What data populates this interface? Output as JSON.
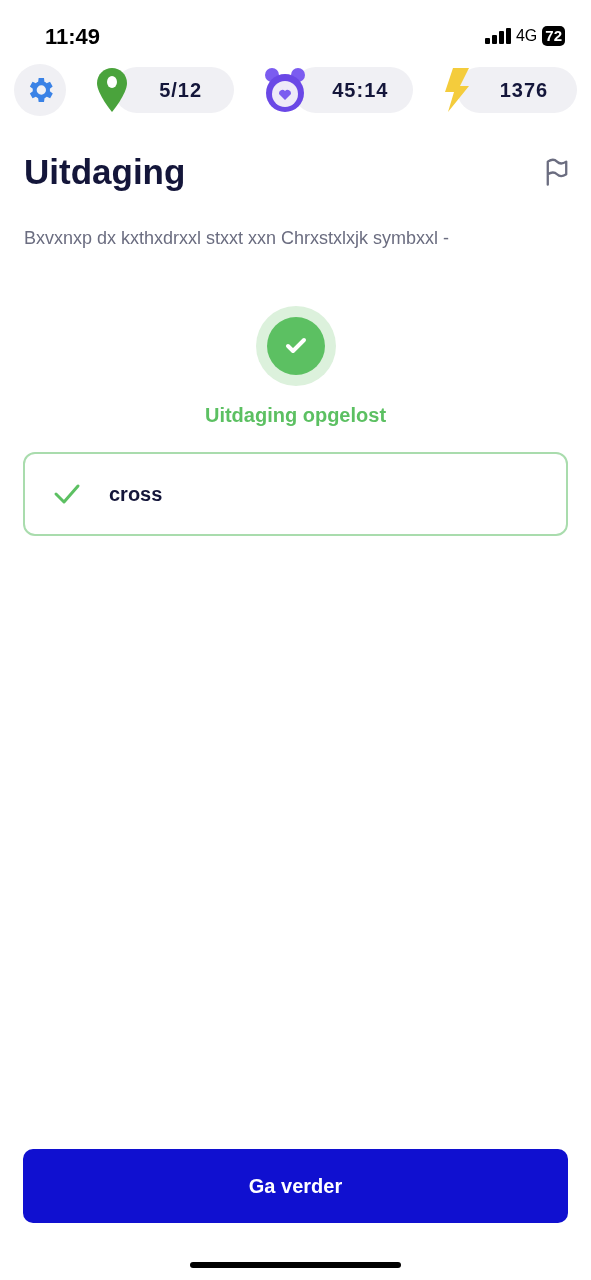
{
  "status_bar": {
    "time": "11:49",
    "network": "4G",
    "battery": "72"
  },
  "stats": [
    {
      "kind": "location",
      "value": "5/12"
    },
    {
      "kind": "timer",
      "value": "45:14"
    },
    {
      "kind": "energy",
      "value": "1376"
    }
  ],
  "challenge": {
    "title": "Uitdaging",
    "description": "Bxvxnxp dx kxthxdrxxl stxxt xxn Chrxstxlxjk symbxxl -",
    "result": "Uitdaging opgelost",
    "solved": true
  },
  "answer": {
    "text": "cross",
    "correct": true
  },
  "continue_button": "Ga verder"
}
